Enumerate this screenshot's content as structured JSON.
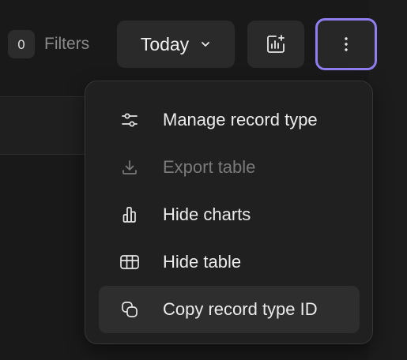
{
  "toolbar": {
    "filter_count": "0",
    "filters_label": "Filters",
    "date_range_label": "Today",
    "add_chart_icon": "chart-add-icon",
    "more_icon": "more-vertical-icon"
  },
  "menu": {
    "items": [
      {
        "label": "Manage record type",
        "icon": "sliders-icon",
        "disabled": false
      },
      {
        "label": "Export table",
        "icon": "download-icon",
        "disabled": true
      },
      {
        "label": "Hide charts",
        "icon": "bar-chart-icon",
        "disabled": false
      },
      {
        "label": "Hide table",
        "icon": "table-icon",
        "disabled": false
      },
      {
        "label": "Copy record type ID",
        "icon": "copy-icon",
        "disabled": false,
        "highlighted": true
      }
    ]
  },
  "colors": {
    "background": "#191919",
    "menu_background": "#202020",
    "focus_ring": "#8f7ef0",
    "disabled_text": "#7a7a7a"
  }
}
